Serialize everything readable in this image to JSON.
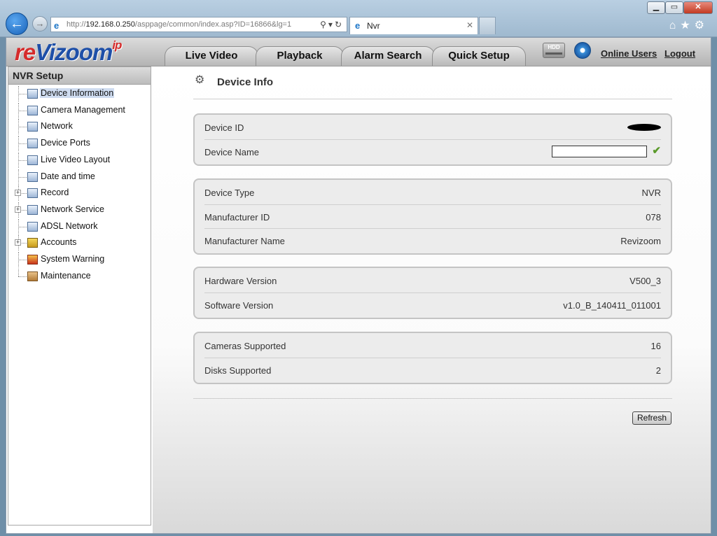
{
  "browser": {
    "window_buttons": {
      "minimize": "▁",
      "maximize": "▭",
      "close": "✕"
    },
    "back_icon": "back-arrow-icon",
    "forward_icon": "forward-arrow-icon",
    "address": {
      "prefix": "http://",
      "host": "192.168.0.250",
      "path": "/asppage/common/index.asp?ID=16866&lg=1"
    },
    "tab": {
      "title": "Nvr"
    },
    "tool_icons": [
      "home-icon",
      "star-icon",
      "gear-icon"
    ]
  },
  "header": {
    "logo": {
      "part1": "re",
      "part2": "Vizoom",
      "sup": "ip"
    },
    "tabs": [
      {
        "label": "Live Video"
      },
      {
        "label": "Playback"
      },
      {
        "label": "Alarm Search"
      },
      {
        "label": "Quick Setup"
      }
    ],
    "hdd_label": "HDD",
    "links": {
      "online_users": "Online Users",
      "logout": "Logout"
    }
  },
  "sidebar": {
    "title": "NVR Setup",
    "items": [
      {
        "label": "Device Information",
        "selected": true,
        "expandable": false
      },
      {
        "label": "Camera Management",
        "expandable": false
      },
      {
        "label": "Network",
        "expandable": false
      },
      {
        "label": "Device Ports",
        "expandable": false
      },
      {
        "label": "Live Video Layout",
        "expandable": false
      },
      {
        "label": "Date and time",
        "expandable": false
      },
      {
        "label": "Record",
        "expandable": true
      },
      {
        "label": "Network Service",
        "expandable": true
      },
      {
        "label": "ADSL Network",
        "expandable": false
      },
      {
        "label": "Accounts",
        "expandable": true
      },
      {
        "label": "System Warning",
        "expandable": false
      },
      {
        "label": "Maintenance",
        "expandable": false
      }
    ]
  },
  "main": {
    "title": "Device Info",
    "groups": [
      {
        "rows": [
          {
            "label": "Device ID"
          },
          {
            "label": "Device Name",
            "value": ""
          }
        ]
      },
      {
        "rows": [
          {
            "label": "Device Type",
            "value": "NVR"
          },
          {
            "label": "Manufacturer ID",
            "value": "078"
          },
          {
            "label": "Manufacturer Name",
            "value": "Revizoom"
          }
        ]
      },
      {
        "rows": [
          {
            "label": "Hardware Version",
            "value": "V500_3"
          },
          {
            "label": "Software Version",
            "value": "v1.0_B_140411_011001"
          }
        ]
      },
      {
        "rows": [
          {
            "label": "Cameras Supported",
            "value": "16"
          },
          {
            "label": "Disks Supported",
            "value": "2"
          }
        ]
      }
    ],
    "refresh_label": "Refresh"
  },
  "colors": {
    "accent_blue": "#1e4fa8",
    "logo_red": "#d52b2b",
    "check_green": "#5a9a2a"
  }
}
